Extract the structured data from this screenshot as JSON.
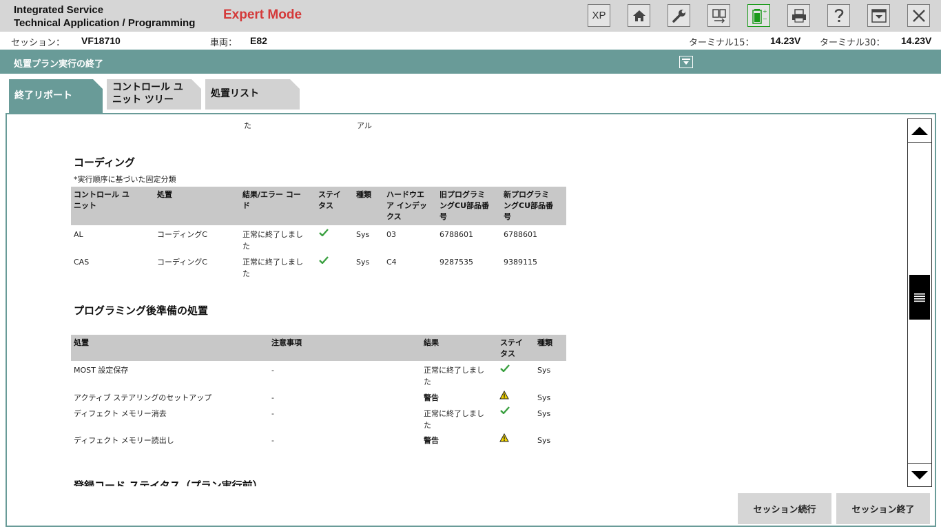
{
  "app": {
    "title_line1": "Integrated Service",
    "title_line2": "Technical Application / Programming",
    "mode": "Expert Mode"
  },
  "toolbar": {
    "xp_label": "XP",
    "icons": [
      "xp-icon",
      "home-icon",
      "wrench-icon",
      "swap-icon",
      "battery-icon",
      "printer-icon",
      "help-icon",
      "window-icon",
      "close-icon"
    ],
    "battery_color": "#1a9a1a"
  },
  "session": {
    "session_label": "セッション：",
    "session_value": "VF18710",
    "vehicle_label": "車両：",
    "vehicle_value": "E82",
    "t15_label": "ターミナル15：",
    "t15_value": "14.23V",
    "t30_label": "ターミナル30：",
    "t30_value": "14.23V"
  },
  "header": {
    "title": "処置プラン実行の終了",
    "accent": "#699b98"
  },
  "tabs": [
    {
      "label": "終了リポート"
    },
    {
      "label_line1": "コントロール ユ",
      "label_line2": "ニット ツリー"
    },
    {
      "label": "処置リスト"
    }
  ],
  "content": {
    "fragment_1": "た",
    "fragment_2": "アル",
    "coding": {
      "heading": "コーディング",
      "note": "*実行順序に基づいた固定分類",
      "headers": {
        "cu": [
          "コントロール ユ",
          "ニット"
        ],
        "measure": "処置",
        "result": [
          "結果/エラー コー",
          "ド"
        ],
        "status": [
          "ステイ",
          "タス"
        ],
        "type": "種類",
        "hw": [
          "ハードウエ",
          "ア インデッ",
          "クス"
        ],
        "old": [
          "旧プログラミ",
          "ングCU部品番",
          "号"
        ],
        "new": [
          "新プログラミ",
          "ングCU部品番",
          "号"
        ]
      },
      "rows": [
        {
          "cu": "AL",
          "measure": "コーディングC",
          "result1": "正常に終了しまし",
          "result2": "た",
          "type": "Sys",
          "hw": "03",
          "old": "6788601",
          "new": "6788601"
        },
        {
          "cu": "CAS",
          "measure": "コーディングC",
          "result1": "正常に終了しまし",
          "result2": "た",
          "type": "Sys",
          "hw": "C4",
          "old": "9287535",
          "new": "9389115"
        }
      ]
    },
    "post": {
      "heading": "プログラミング後準備の処置",
      "headers": {
        "measure": "処置",
        "notes": "注意事項",
        "result": "結果",
        "status": [
          "ステイ",
          "タス"
        ],
        "type": "種類"
      },
      "rows": [
        {
          "measure": "MOST 設定保存",
          "notes": "-",
          "result1": "正常に終了しまし",
          "result2": "た",
          "status": "ok",
          "type": "Sys"
        },
        {
          "measure": "アクティブ ステアリングのセットアップ",
          "notes": "-",
          "result1": "警告",
          "result2": "",
          "status": "warning",
          "type": "Sys"
        },
        {
          "measure": "ディフェクト メモリー消去",
          "notes": "-",
          "result1": "正常に終了しまし",
          "result2": "た",
          "status": "ok",
          "type": "Sys"
        },
        {
          "measure": "ディフェクト メモリー読出し",
          "notes": "-",
          "result1": "警告",
          "result2": "",
          "status": "warning",
          "type": "Sys"
        }
      ]
    },
    "next_heading": "登録コード ステイタス（プラン実行前）"
  },
  "buttons": {
    "continue": "セッション続行",
    "end": "セッション終了"
  }
}
